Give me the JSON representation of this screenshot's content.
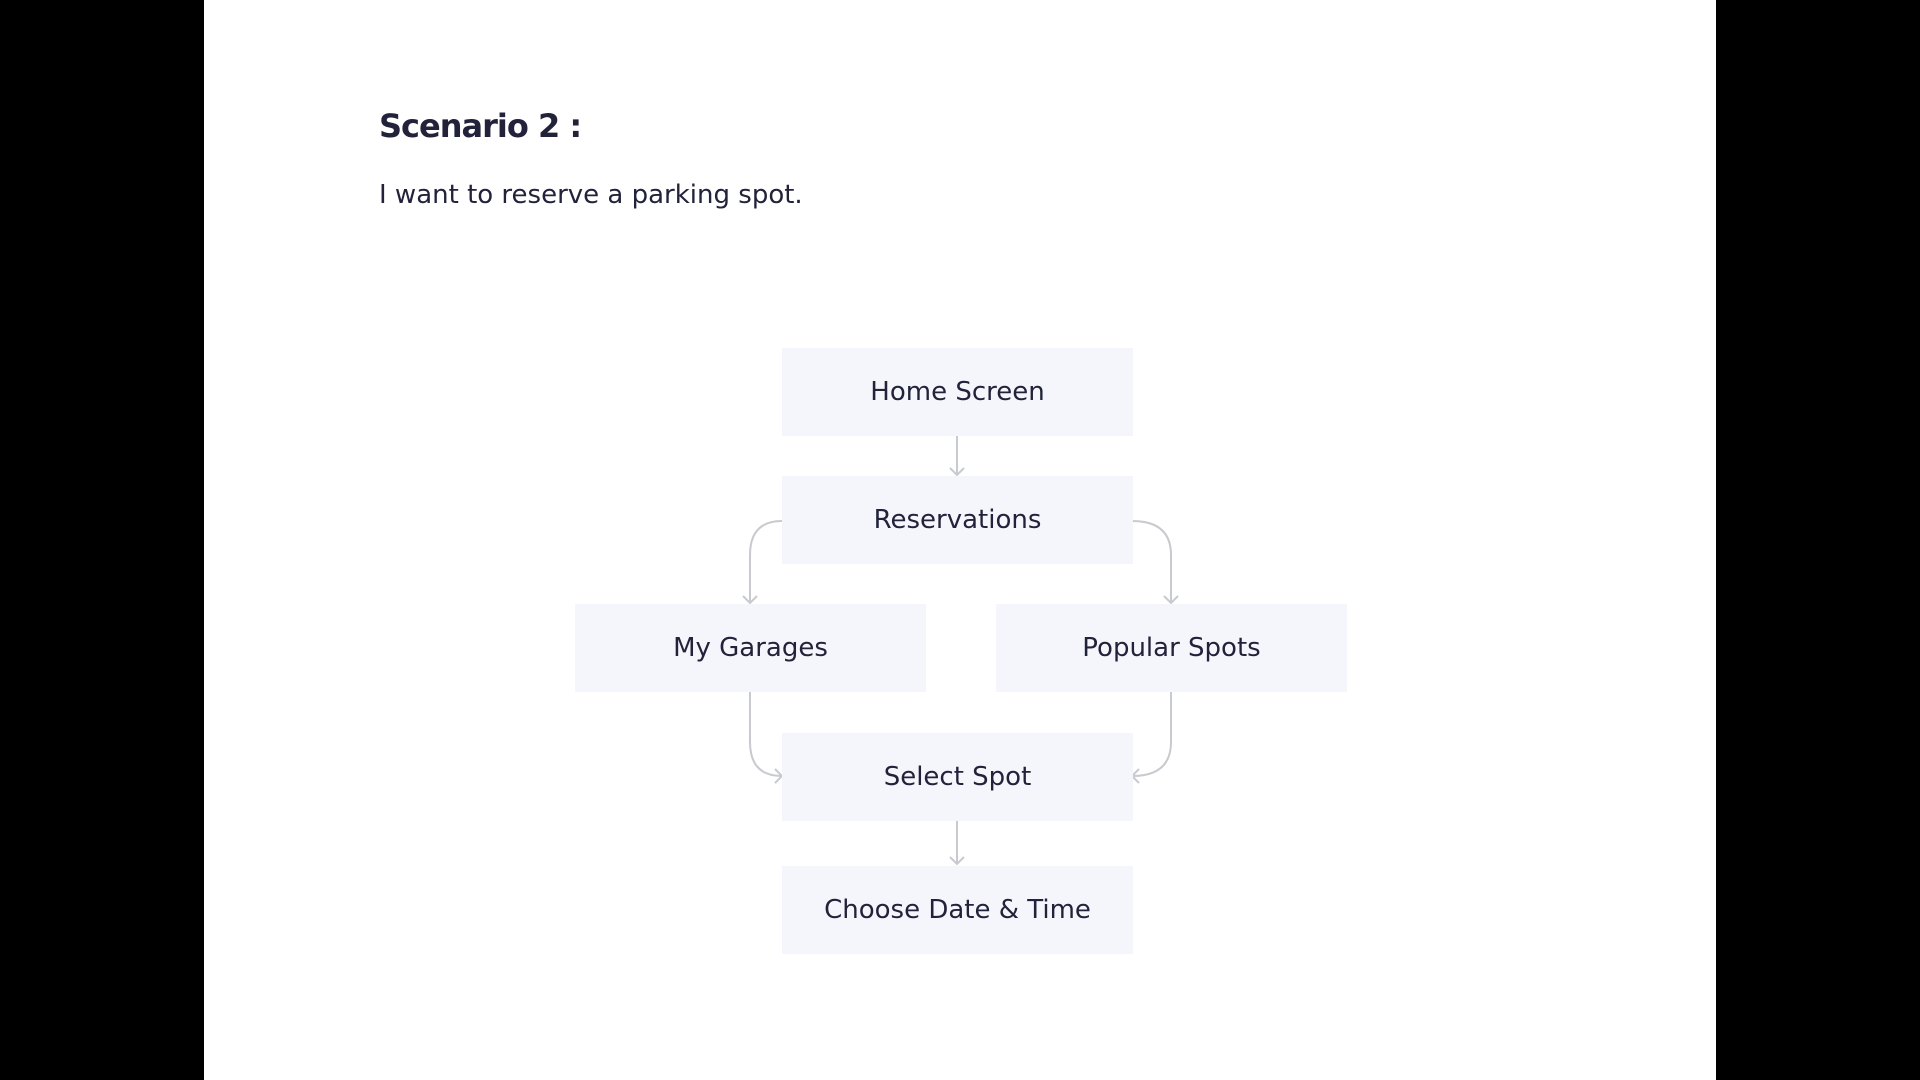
{
  "scenario": {
    "title": "Scenario 2 :",
    "description": "I want to reserve a parking spot."
  },
  "flow": {
    "nodes": {
      "home_screen": "Home Screen",
      "reservations": "Reservations",
      "my_garages": "My Garages",
      "popular_spots": "Popular Spots",
      "select_spot": "Select Spot",
      "choose_date_time": "Choose Date & Time"
    },
    "edges": [
      {
        "from": "Home Screen",
        "to": "Reservations"
      },
      {
        "from": "Reservations",
        "to": "My Garages"
      },
      {
        "from": "Reservations",
        "to": "Popular Spots"
      },
      {
        "from": "My Garages",
        "to": "Select Spot"
      },
      {
        "from": "Popular Spots",
        "to": "Select Spot"
      },
      {
        "from": "Select Spot",
        "to": "Choose Date & Time"
      }
    ]
  },
  "colors": {
    "background": "#000000",
    "slide": "#ffffff",
    "text": "#22233a",
    "node_fill": "#f4f6fb",
    "connector": "#c8cad0"
  }
}
